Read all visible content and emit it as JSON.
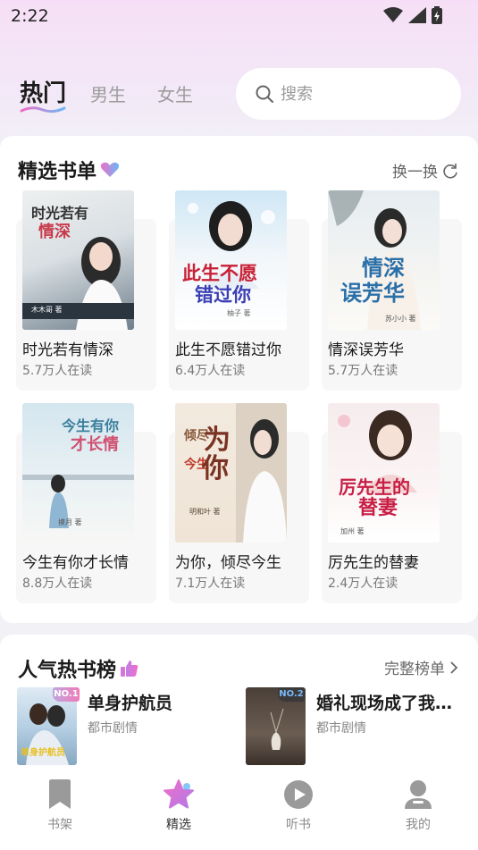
{
  "status": {
    "time": "2:22"
  },
  "top_tabs": [
    {
      "label": "热门",
      "active": true
    },
    {
      "label": "男生",
      "active": false
    },
    {
      "label": "女生",
      "active": false
    }
  ],
  "search": {
    "placeholder": "搜索"
  },
  "featured": {
    "title": "精选书单",
    "refresh_label": "换一换",
    "books": [
      {
        "title": "时光若有情深",
        "readers": "5.7万人在读",
        "cover_text": "时光若有情深",
        "cover_author": "木木哥 著"
      },
      {
        "title": "此生不愿错过你",
        "readers": "6.4万人在读",
        "cover_text": "此生不愿错过你",
        "cover_author": "柚子 著"
      },
      {
        "title": "情深误芳华",
        "readers": "5.7万人在读",
        "cover_text": "情深误芳华",
        "cover_author": "苏小小 著"
      },
      {
        "title": "今生有你才长情",
        "readers": "8.8万人在读",
        "cover_text": "今生有你才长情",
        "cover_author": "摸月 著"
      },
      {
        "title": "为你，倾尽今生",
        "readers": "7.1万人在读",
        "cover_text": "为你倾尽今生",
        "cover_author": "明和叶 著"
      },
      {
        "title": "厉先生的替妻",
        "readers": "2.4万人在读",
        "cover_text": "厉先生的替妻",
        "cover_author": "加州 著"
      }
    ]
  },
  "hot": {
    "title": "人气热书榜",
    "full_list_label": "完整榜单",
    "items": [
      {
        "rank": "NO.1",
        "title": "单身护航员",
        "genre": "都市剧情",
        "cover_text": "单身护航员"
      },
      {
        "rank": "NO.2",
        "title": "婚礼现场成了我…",
        "genre": "都市剧情"
      }
    ]
  },
  "bottom_nav": [
    {
      "label": "书架",
      "icon": "bookmark-icon"
    },
    {
      "label": "精选",
      "icon": "star-icon",
      "active": true
    },
    {
      "label": "听书",
      "icon": "play-icon"
    },
    {
      "label": "我的",
      "icon": "user-icon"
    }
  ],
  "colors": {
    "accent_pink": "#f06ec8",
    "accent_blue": "#6ab8f5",
    "nav_inactive": "#9a9a9a"
  }
}
